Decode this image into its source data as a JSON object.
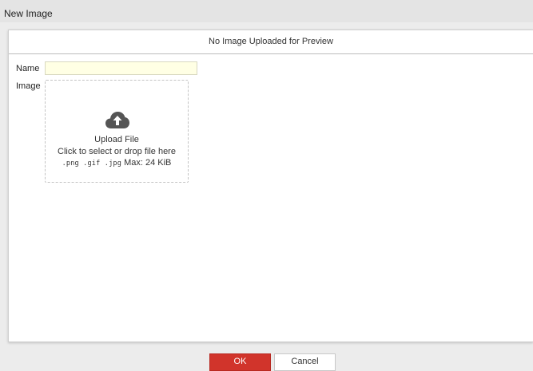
{
  "window": {
    "title": "New Image"
  },
  "preview": {
    "header": "No Image Uploaded for Preview"
  },
  "form": {
    "name_label": "Name",
    "name_value": "",
    "image_label": "Image"
  },
  "upload": {
    "icon": "cloud-upload-icon",
    "title": "Upload File",
    "hint": "Click to select or drop file here",
    "types": ".png .gif .jpg",
    "max": "Max: 24 KiB"
  },
  "buttons": {
    "ok": "OK",
    "cancel": "Cancel"
  },
  "colors": {
    "ok_button": "#d1342b",
    "name_input_bg": "#ffffe4",
    "icon": "#555555"
  }
}
